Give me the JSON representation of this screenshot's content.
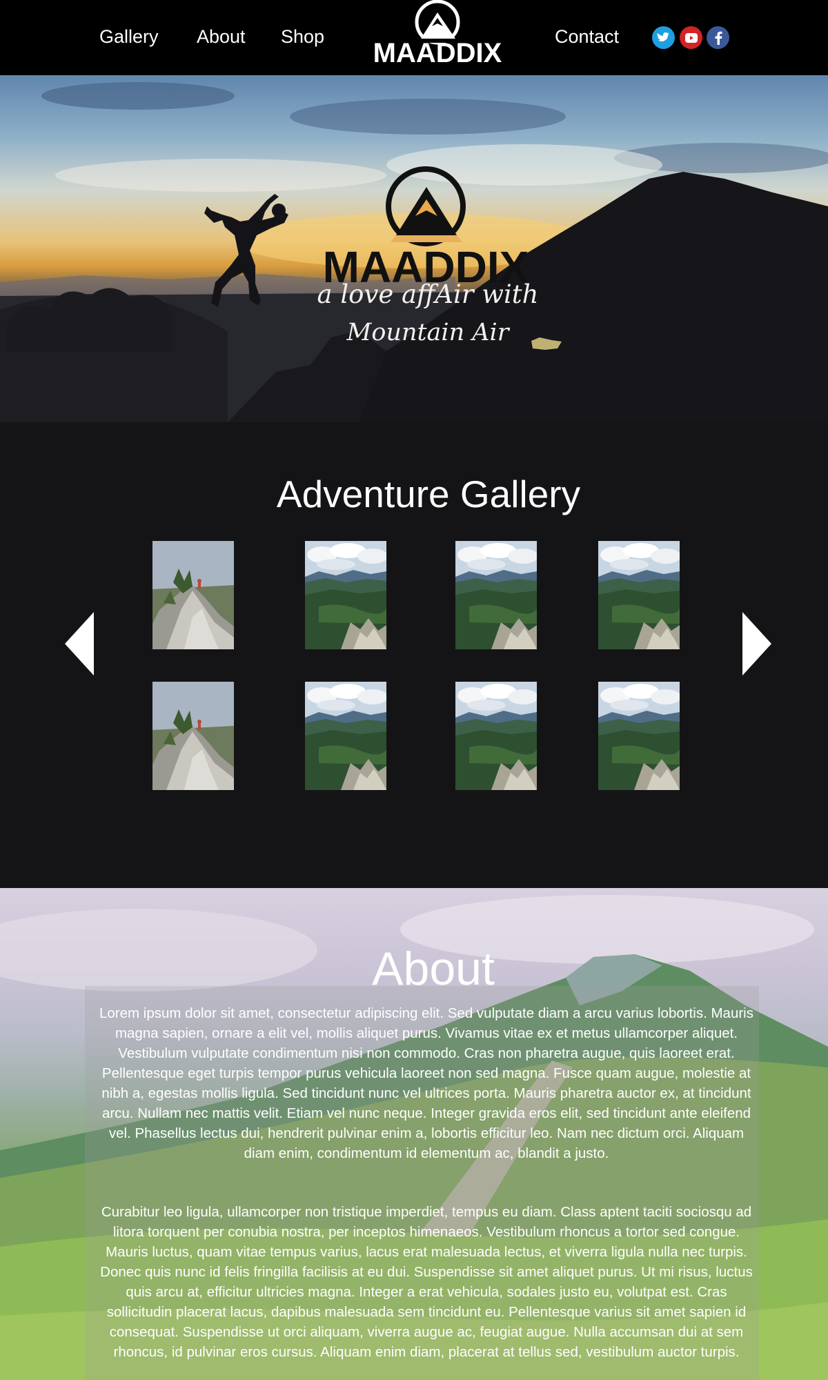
{
  "nav": {
    "links": [
      "Gallery",
      "About",
      "Shop",
      "Contact"
    ],
    "brand": "MAADDIX",
    "social": [
      "twitter-icon",
      "youtube-icon",
      "facebook-icon"
    ]
  },
  "hero": {
    "brand": "MAADDIX",
    "tagline_line1": "a love affAir with",
    "tagline_line2": "Mountain Air"
  },
  "gallery": {
    "title": "Adventure Gallery",
    "thumbnails": [
      "rock-climber",
      "mountain-valley",
      "mountain-valley",
      "mountain-valley",
      "rock-climber",
      "mountain-valley",
      "mountain-valley",
      "mountain-valley"
    ]
  },
  "about": {
    "title": "About",
    "paragraphs": [
      "Lorem ipsum dolor sit amet, consectetur adipiscing elit. Sed vulputate diam a arcu varius lobortis. Mauris magna sapien, ornare a elit vel, mollis aliquet purus. Vivamus vitae ex et metus ullamcorper aliquet. Vestibulum vulputate condimentum nisi non commodo. Cras non pharetra augue, quis laoreet erat. Pellentesque eget turpis tempor purus vehicula laoreet non sed magna. Fusce quam augue, molestie at nibh a, egestas mollis ligula. Sed tincidunt nunc vel ultrices porta. Mauris pharetra auctor ex, at tincidunt arcu. Nullam nec mattis velit. Etiam vel nunc neque. Integer gravida eros elit, sed tincidunt ante eleifend vel. Phasellus lectus dui, hendrerit pulvinar enim a, lobortis efficitur leo. Nam nec dictum orci. Aliquam diam enim, condimentum id elementum ac, blandit a justo.",
      "Curabitur leo ligula, ullamcorper non tristique imperdiet, tempus eu diam. Class aptent taciti sociosqu ad litora torquent per conubia nostra, per inceptos himenaeos. Vestibulum rhoncus a tortor sed congue. Mauris luctus, quam vitae tempus varius, lacus erat malesuada lectus, et viverra ligula nulla nec turpis. Donec quis nunc id felis fringilla facilisis at eu dui. Suspendisse sit amet aliquet purus. Ut mi risus, luctus quis arcu at, efficitur ultricies magna. Integer a erat vehicula, sodales justo eu, volutpat est. Cras sollicitudin placerat lacus, dapibus malesuada sem tincidunt eu. Pellentesque varius sit amet sapien id consequat. Suspendisse ut orci aliquam, viverra augue ac, feugiat augue. Nulla accumsan dui at sem rhoncus, id pulvinar eros cursus. Aliquam enim diam, placerat at tellus sed, vestibulum auctor turpis."
    ]
  },
  "colors": {
    "nav_bg": "#000000",
    "page_bg": "#141416",
    "twitter": "#1d9fe0",
    "youtube": "#d32424",
    "facebook": "#3b5998"
  }
}
